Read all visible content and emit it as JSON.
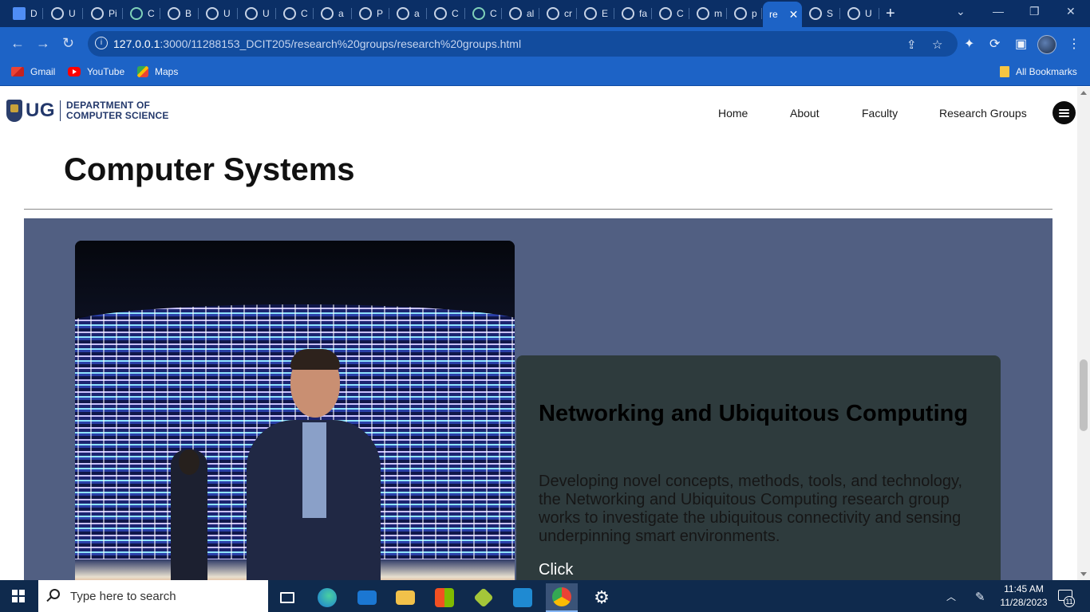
{
  "browser": {
    "tabs": [
      {
        "label": "D",
        "icon": "docs-icon"
      },
      {
        "label": "U",
        "icon": "loading-icon"
      },
      {
        "label": "Pi",
        "icon": "loading-icon"
      },
      {
        "label": "C",
        "icon": "chatgpt-icon"
      },
      {
        "label": "B",
        "icon": "site-icon"
      },
      {
        "label": "U",
        "icon": "site-icon"
      },
      {
        "label": "U",
        "icon": "site-icon"
      },
      {
        "label": "C",
        "icon": "site-icon"
      },
      {
        "label": "a",
        "icon": "github-icon"
      },
      {
        "label": "P",
        "icon": "github-icon"
      },
      {
        "label": "a",
        "icon": "github-icon"
      },
      {
        "label": "C",
        "icon": "site-icon"
      },
      {
        "label": "C",
        "icon": "chatgpt-icon"
      },
      {
        "label": "al",
        "icon": "globe-icon"
      },
      {
        "label": "cr",
        "icon": "globe-icon"
      },
      {
        "label": "E",
        "icon": "globe-icon"
      },
      {
        "label": "fa",
        "icon": "globe-icon"
      },
      {
        "label": "C",
        "icon": "globe-icon"
      },
      {
        "label": "m",
        "icon": "globe-icon"
      },
      {
        "label": "p",
        "icon": "globe-icon"
      },
      {
        "label": "re",
        "icon": "none",
        "active": true
      },
      {
        "label": "S",
        "icon": "globe-icon"
      },
      {
        "label": "U",
        "icon": "globe-icon"
      }
    ],
    "url_host": "127.0.0.1",
    "url_rest": ":3000/11288153_DCIT205/research%20groups/research%20groups.html",
    "bookmarks": [
      {
        "label": "Gmail",
        "icon": "gmail-icon"
      },
      {
        "label": "YouTube",
        "icon": "youtube-icon"
      },
      {
        "label": "Maps",
        "icon": "maps-icon"
      }
    ],
    "all_bookmarks": "All Bookmarks"
  },
  "site": {
    "logo": {
      "ug": "UG",
      "dept_line1": "DEPARTMENT OF",
      "dept_line2": "COMPUTER SCIENCE"
    },
    "nav": {
      "home": "Home",
      "about": "About",
      "faculty": "Faculty",
      "research_groups": "Research Groups"
    }
  },
  "page": {
    "title": "Computer Systems",
    "group": {
      "title": "Networking and Ubiquitous Computing",
      "description": "Developing novel concepts, methods, tools, and technology, the Networking and Ubiquitous Computing research group works to investigate the ubiquitous connectivity and sensing underpinning smart environments.",
      "link": "Click"
    },
    "colors": {
      "section_bg": "#515f82",
      "card_bg": "#2e3b3d"
    }
  },
  "taskbar": {
    "search_placeholder": "Type here to search",
    "time": "11:45 AM",
    "date": "11/28/2023",
    "notification_count": "11"
  }
}
